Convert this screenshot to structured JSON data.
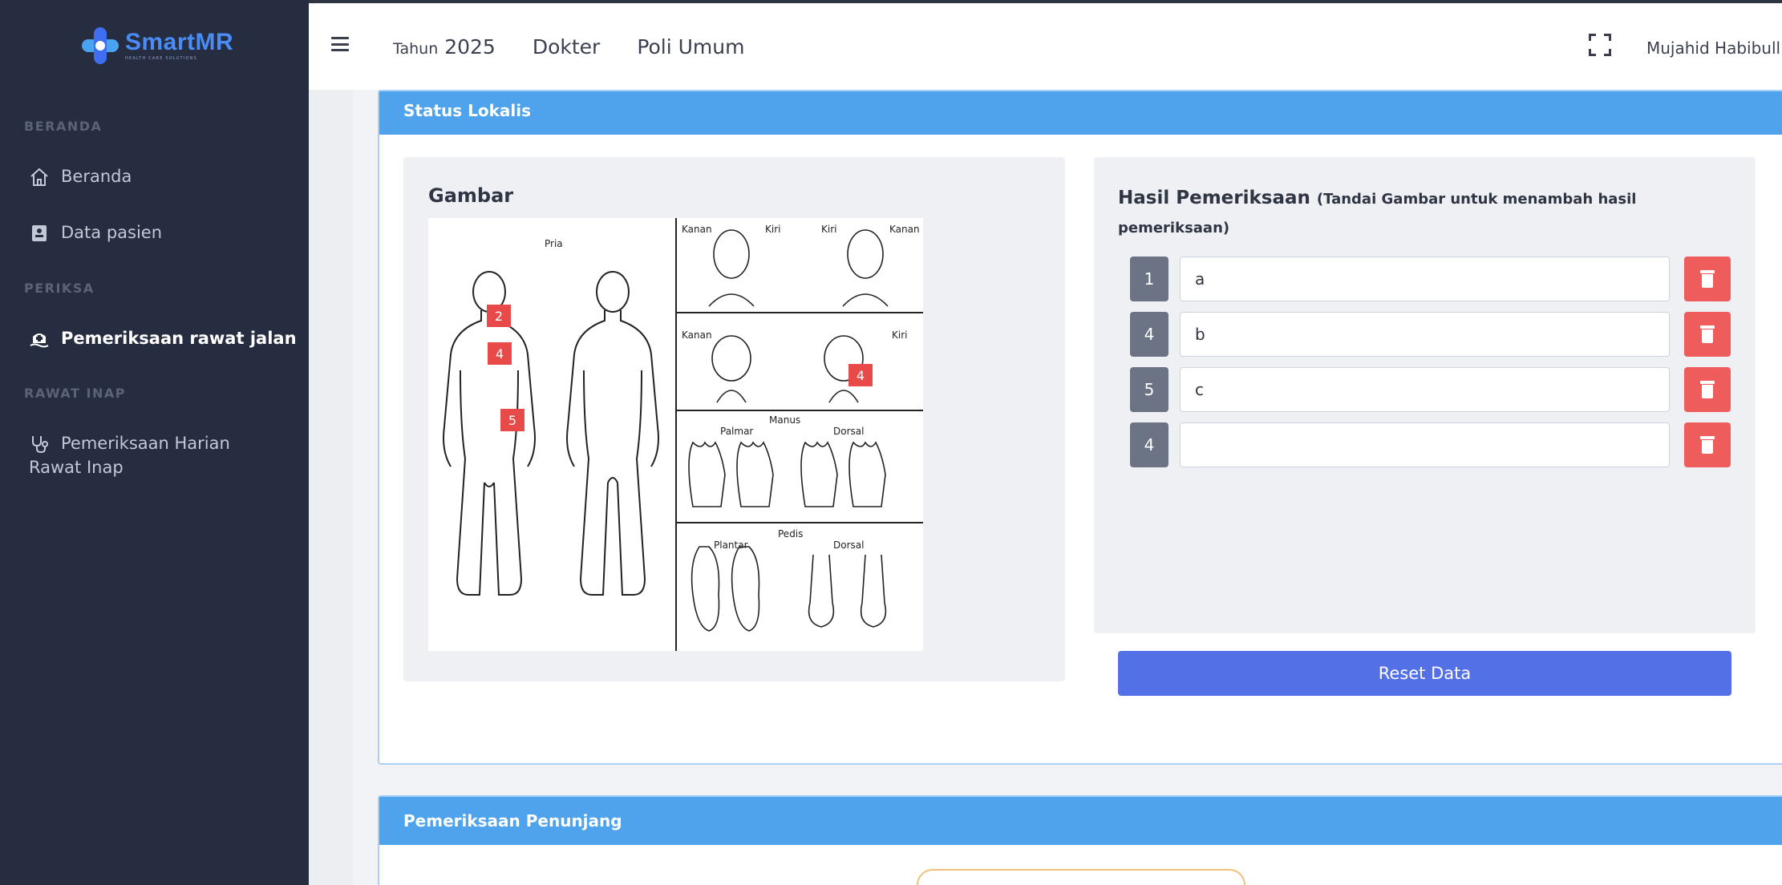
{
  "app": {
    "logo_name": "SmartMR",
    "logo_tagline": "HEALTH CARE SOLUTIONS"
  },
  "sidebar": {
    "sections": [
      {
        "label": "BERANDA"
      },
      {
        "label": "PERIKSA"
      },
      {
        "label": "RAWAT INAP"
      }
    ],
    "items": [
      {
        "label": "Beranda",
        "icon": "home-icon"
      },
      {
        "label": "Data pasien",
        "icon": "id-card-icon"
      },
      {
        "label": "Pemeriksaan rawat jalan",
        "icon": "hospital-icon",
        "active": true
      },
      {
        "label_line1": "Pemeriksaan Harian",
        "label_line2": "Rawat Inap",
        "icon": "stethoscope-icon"
      }
    ]
  },
  "header": {
    "year_label": "Tahun",
    "year_value": "2025",
    "role": "Dokter",
    "unit": "Poli Umum",
    "user_name": "Mujahid Habibull"
  },
  "status_lokalis": {
    "title": "Status Lokalis",
    "image_panel_title": "Gambar",
    "figure_labels": {
      "pria": "Pria",
      "kanan": "Kanan",
      "kiri": "Kiri",
      "manus": "Manus",
      "palmar": "Palmar",
      "dorsal": "Dorsal",
      "pedis": "Pedis",
      "plantar": "Plantar"
    },
    "markers": [
      {
        "label": "2"
      },
      {
        "label": "4"
      },
      {
        "label": "5"
      },
      {
        "label": "4"
      }
    ],
    "results_title": "Hasil Pemeriksaan",
    "results_hint": "(Tandai Gambar untuk menambah hasil pemeriksaan)",
    "results": [
      {
        "number": "1",
        "value": "a"
      },
      {
        "number": "4",
        "value": "b"
      },
      {
        "number": "5",
        "value": "c"
      },
      {
        "number": "4",
        "value": ""
      }
    ],
    "reset_label": "Reset Data"
  },
  "pemeriksaan_penunjang": {
    "title": "Pemeriksaan Penunjang"
  },
  "colors": {
    "sidebar_bg": "#272d40",
    "card_header": "#4ea3ec",
    "delete": "#ee5c5c",
    "primary": "#5470e6",
    "badge": "#6b7385"
  }
}
